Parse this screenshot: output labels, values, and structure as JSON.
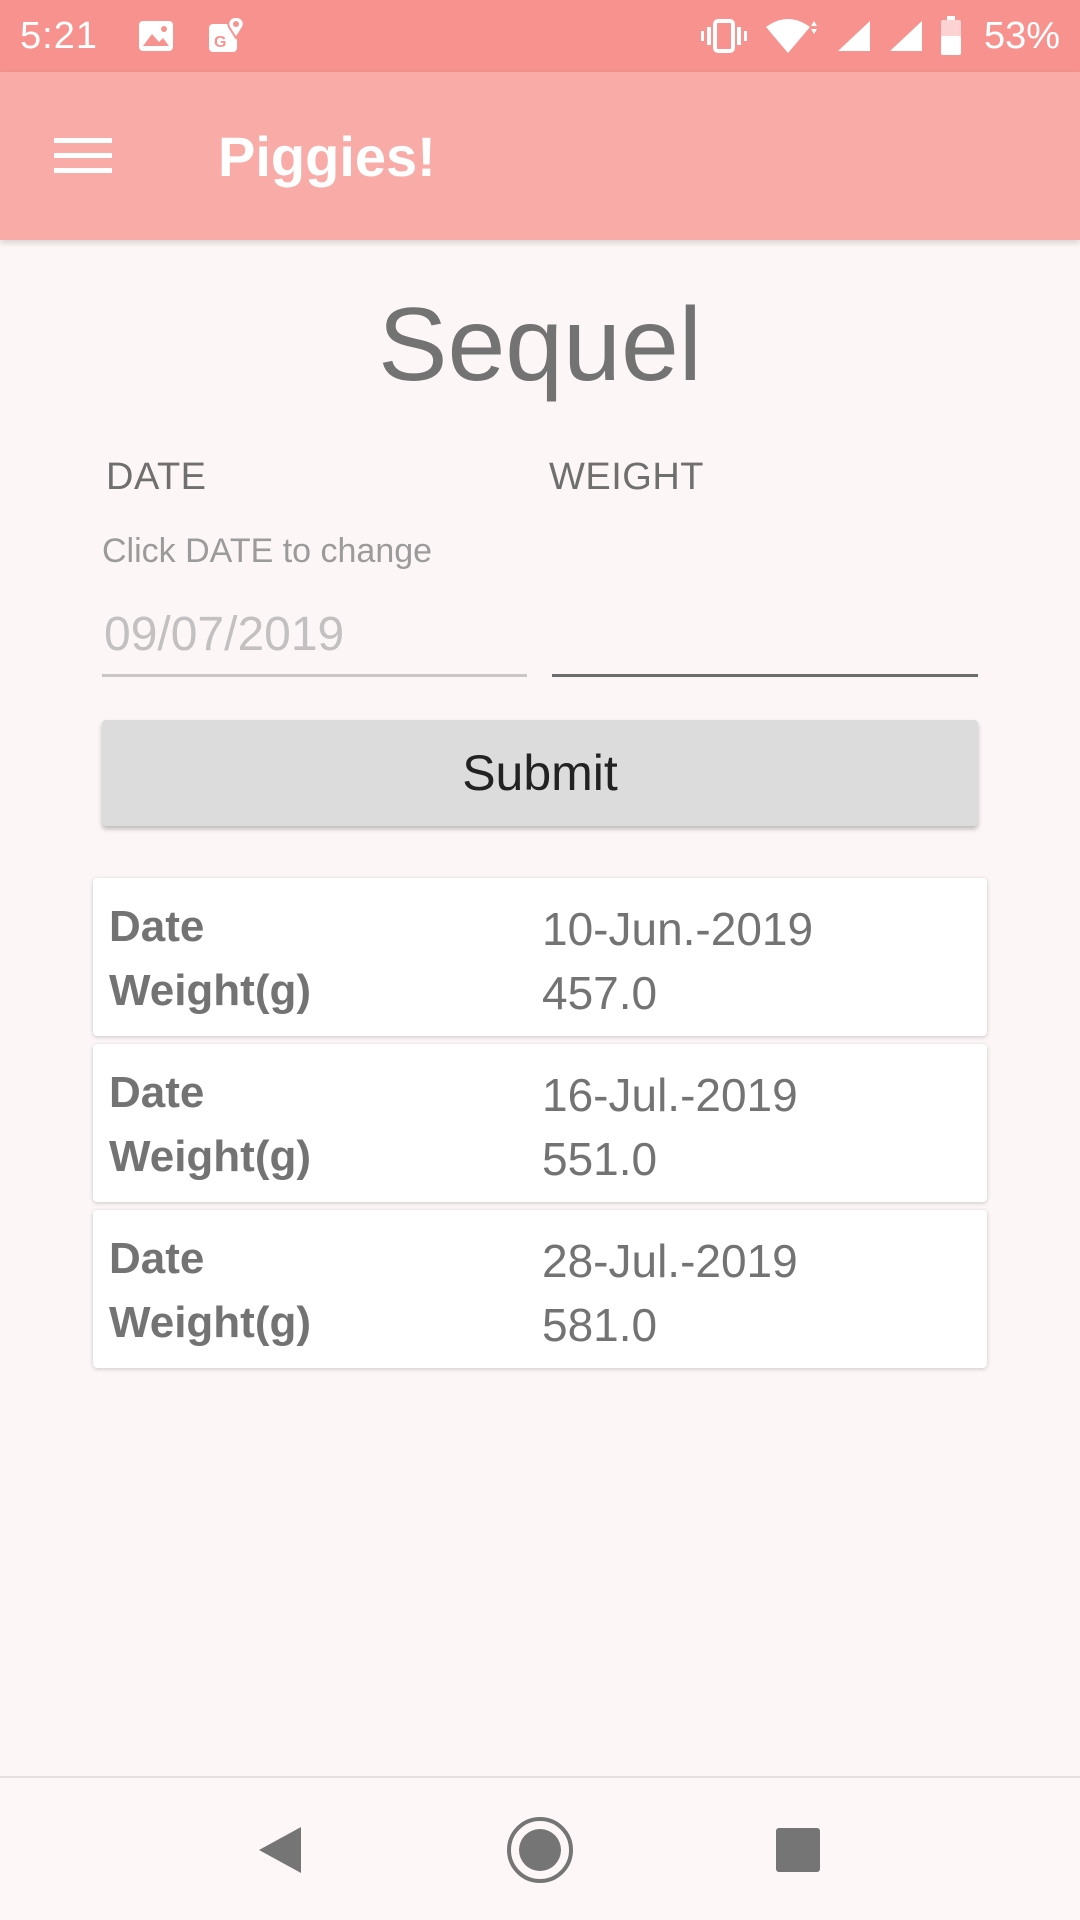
{
  "status_bar": {
    "time": "5:21",
    "battery": "53%",
    "icons": [
      "gallery-icon",
      "maps-icon",
      "vibrate-icon",
      "wifi-icon",
      "signal-icon",
      "signal-icon",
      "battery-icon"
    ]
  },
  "app_bar": {
    "title": "Piggies!",
    "menu_icon": "hamburger-menu-icon"
  },
  "page": {
    "heading": "Sequel",
    "date_label": "DATE",
    "weight_label": "WEIGHT",
    "date_hint": "Click DATE to change",
    "date_value": "09/07/2019",
    "weight_value": "",
    "submit_label": "Submit"
  },
  "records": [
    {
      "date_label": "Date",
      "date": "10-Jun.-2019",
      "weight_label": "Weight(g)",
      "weight": "457.0"
    },
    {
      "date_label": "Date",
      "date": "16-Jul.-2019",
      "weight_label": "Weight(g)",
      "weight": "551.0"
    },
    {
      "date_label": "Date",
      "date": "28-Jul.-2019",
      "weight_label": "Weight(g)",
      "weight": "581.0"
    }
  ],
  "nav_bar": {
    "icons": [
      "back-icon",
      "home-icon",
      "recents-icon"
    ]
  },
  "colors": {
    "status_bar": "#f7928e",
    "app_bar": "#f9aca7",
    "background": "#fdf6f6",
    "button": "#dcdcdc"
  }
}
